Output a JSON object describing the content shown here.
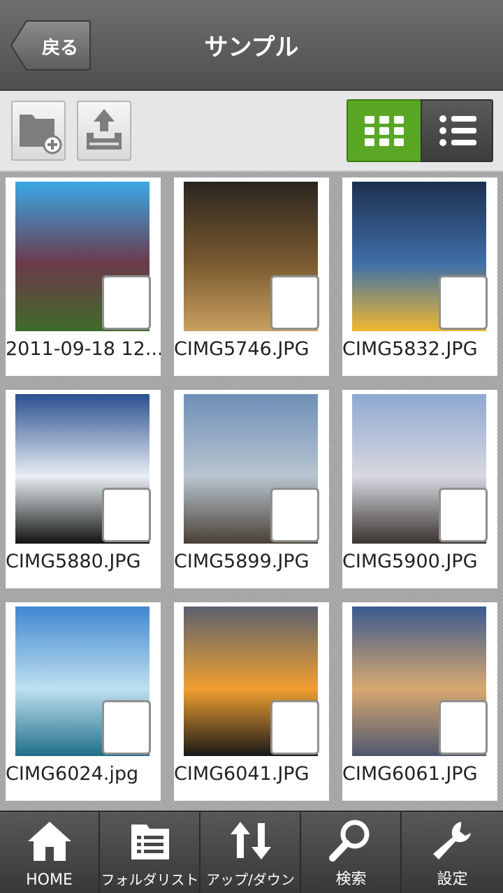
{
  "header": {
    "back_label": "戻る",
    "title": "サンプル"
  },
  "toolbar": {
    "new_folder_icon": "folder-add-icon",
    "upload_icon": "upload-tray-icon",
    "view_grid_icon": "grid-view-icon",
    "view_list_icon": "list-view-icon",
    "active_view": "grid",
    "accent": "#5aa726"
  },
  "files": [
    {
      "name": "2011-09-18 12...",
      "colors": [
        "#3aa8e6",
        "#6b3a4a",
        "#3f6b2a"
      ]
    },
    {
      "name": "CIMG5746.JPG",
      "colors": [
        "#2a2520",
        "#7a5a30",
        "#c8a060"
      ]
    },
    {
      "name": "CIMG5832.JPG",
      "colors": [
        "#1e3050",
        "#3f6fa8",
        "#f0b830"
      ]
    },
    {
      "name": "CIMG5880.JPG",
      "colors": [
        "#2a4f8f",
        "#e8eef4",
        "#121410"
      ]
    },
    {
      "name": "CIMG5899.JPG",
      "colors": [
        "#6f8fb8",
        "#b8c4d0",
        "#4a4036"
      ]
    },
    {
      "name": "CIMG5900.JPG",
      "colors": [
        "#8fa8d0",
        "#d8d8e0",
        "#3a3430"
      ]
    },
    {
      "name": "CIMG6024.jpg",
      "colors": [
        "#3f88d0",
        "#bfe0f0",
        "#1f6f88"
      ]
    },
    {
      "name": "CIMG6041.JPG",
      "colors": [
        "#5a6070",
        "#f0a030",
        "#181818"
      ]
    },
    {
      "name": "CIMG6061.JPG",
      "colors": [
        "#3a5a90",
        "#d8a870",
        "#4f5870"
      ]
    }
  ],
  "bottom_nav": [
    {
      "label": "HOME",
      "icon": "home-icon"
    },
    {
      "label": "フォルダリスト",
      "icon": "folder-list-icon"
    },
    {
      "label": "アップ/ダウン",
      "icon": "up-down-arrows-icon"
    },
    {
      "label": "検索",
      "icon": "search-icon"
    },
    {
      "label": "設定",
      "icon": "wrench-icon"
    }
  ]
}
